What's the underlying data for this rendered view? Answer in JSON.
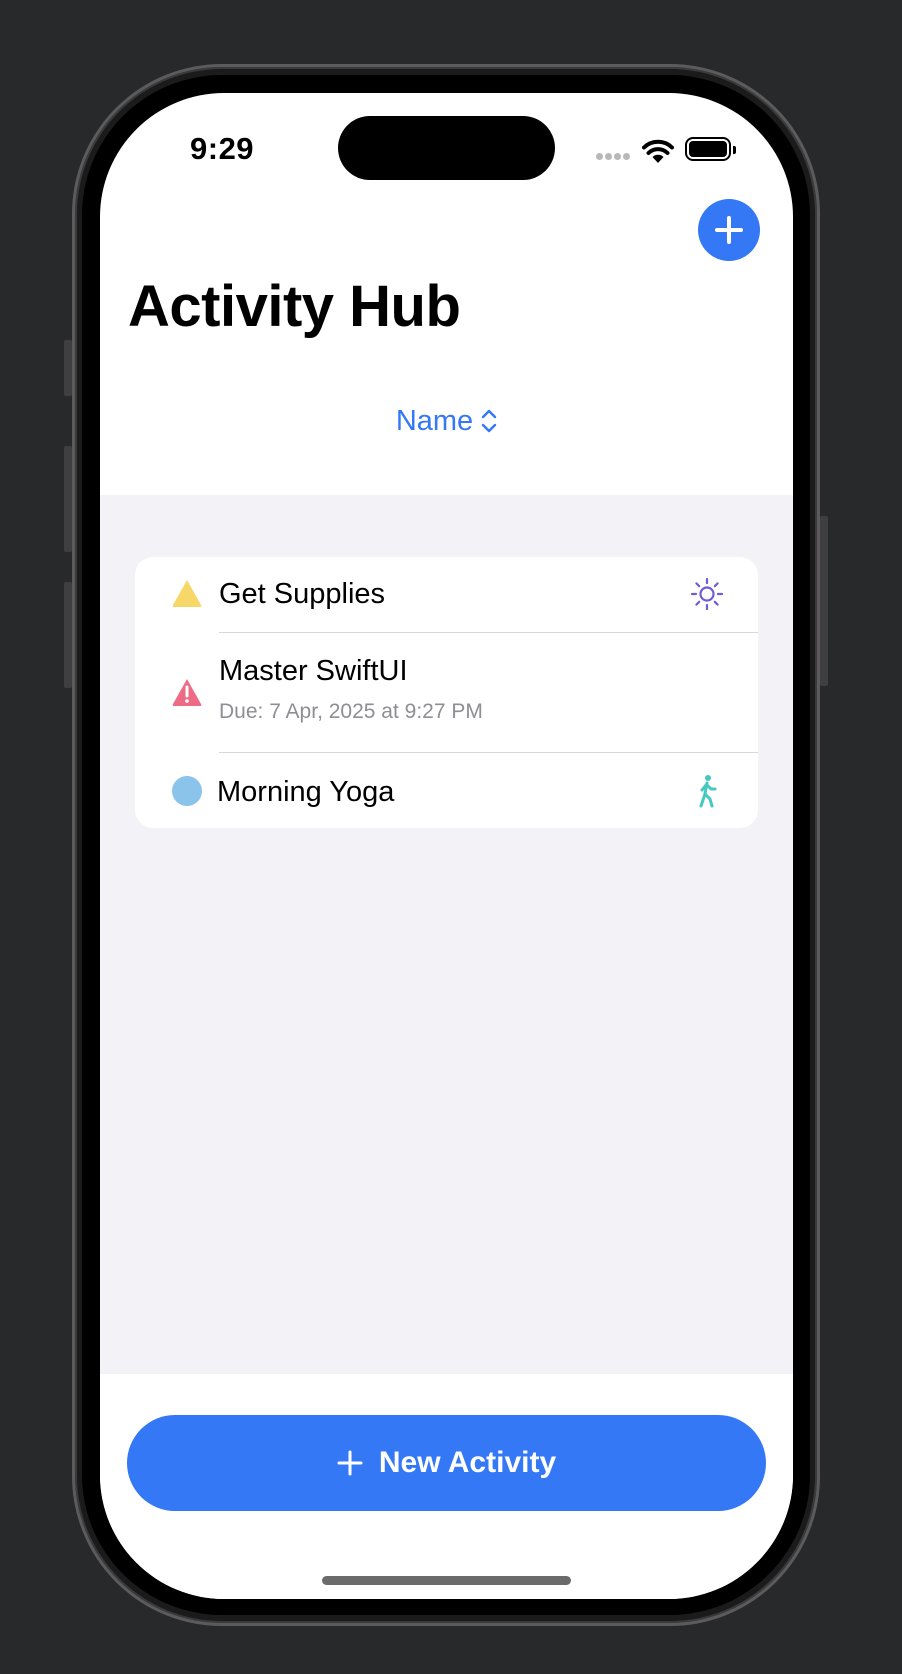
{
  "status_bar": {
    "time": "9:29"
  },
  "header": {
    "title": "Activity Hub",
    "add_icon": "plus-icon"
  },
  "sort": {
    "label": "Name",
    "icon": "chevron-up-down-icon"
  },
  "activities": [
    {
      "title": "Get Supplies",
      "subtitle": "",
      "priority_icon": "triangle-icon",
      "priority_color": "#f7d767",
      "trailing_icon": "sun-icon",
      "trailing_color": "#6e5dd6"
    },
    {
      "title": "Master SwiftUI",
      "subtitle": "Due: 7 Apr, 2025 at 9:27 PM",
      "priority_icon": "exclamation-triangle-icon",
      "priority_color": "#ee6b86",
      "trailing_icon": "",
      "trailing_color": ""
    },
    {
      "title": "Morning Yoga",
      "subtitle": "",
      "priority_icon": "circle-icon",
      "priority_color": "#8ac4ea",
      "trailing_icon": "figure-walk-icon",
      "trailing_color": "#45c8c0"
    }
  ],
  "footer": {
    "new_activity_label": "New Activity",
    "icon": "plus-icon"
  },
  "colors": {
    "accent": "#3478f6",
    "grouped_background": "#f2f2f7"
  }
}
